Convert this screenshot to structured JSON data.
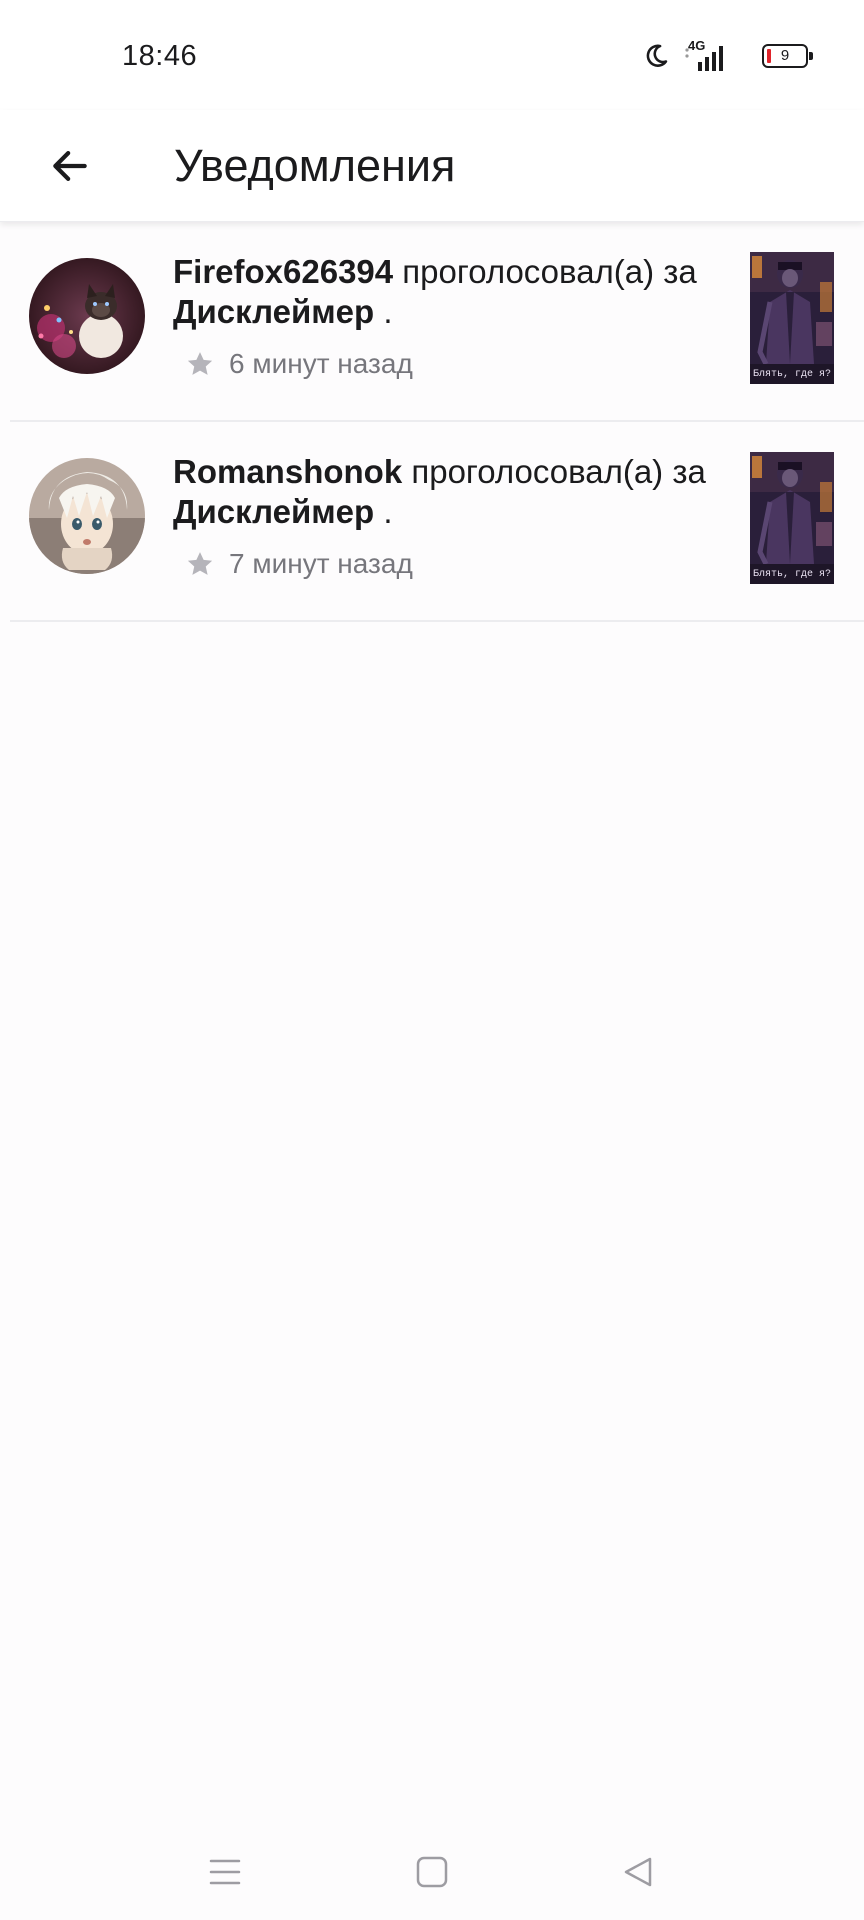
{
  "status_bar": {
    "time": "18:46",
    "network": "4G",
    "battery_level": "9",
    "icons": [
      "moon-icon",
      "signal-icon",
      "battery-icon"
    ]
  },
  "app_bar": {
    "back_icon": "arrow-left-icon",
    "title": "Уведомления"
  },
  "notifications": [
    {
      "user": "Firefox626394",
      "action": " проголосовал(а) за ",
      "work": "Дисклеймер",
      "suffix": " .",
      "time": "6 минут назад",
      "icon": "star-icon"
    },
    {
      "user": "Romanshonok",
      "action": " проголосовал(а) за ",
      "work": "Дисклеймер",
      "suffix": " .",
      "time": "7 минут назад",
      "icon": "star-icon"
    }
  ],
  "thumbnail_caption": "Блять, где я?",
  "nav_bar": {
    "icons": [
      "menu-icon",
      "home-square-icon",
      "back-triangle-icon"
    ]
  },
  "colors": {
    "background": "#fdfcfd",
    "text": "#1b1b1d",
    "muted": "#76767c",
    "divider": "#ececef",
    "battery_low": "#e0242b"
  }
}
